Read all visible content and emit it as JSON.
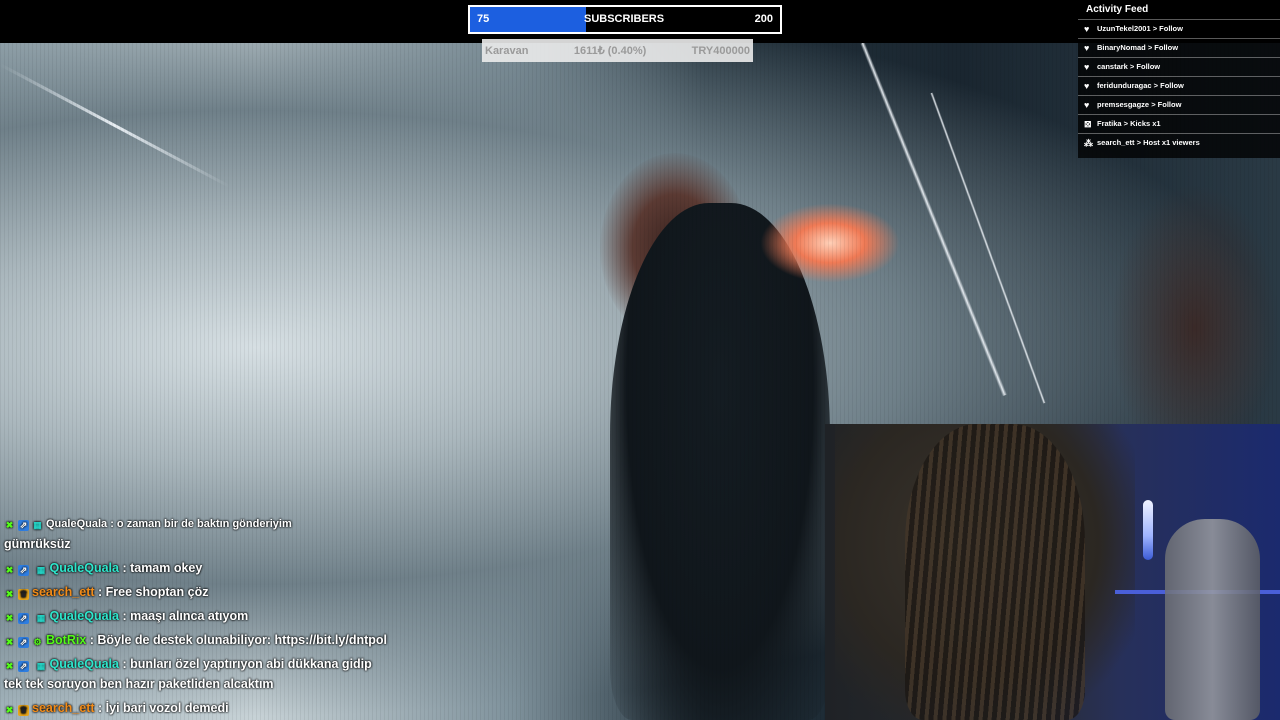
{
  "goal": {
    "current": "75",
    "label": "SUBSCRIBERS",
    "target": "200",
    "progress_fraction": 0.375,
    "fill_color": "#1c5fe0"
  },
  "donation": {
    "name": "Karavan",
    "amount": "1611₺ (0.40%)",
    "target": "TRY400000"
  },
  "activity_feed": {
    "title": "Activity Feed",
    "items": [
      {
        "icon": "heart-icon",
        "text": "UzunTekel2001 > Follow"
      },
      {
        "icon": "heart-icon",
        "text": "BinaryNomad > Follow"
      },
      {
        "icon": "heart-icon",
        "text": "canstark > Follow"
      },
      {
        "icon": "heart-icon",
        "text": "feridunduragac > Follow"
      },
      {
        "icon": "heart-icon",
        "text": "premsesgagze > Follow"
      },
      {
        "icon": "kick-icon",
        "text": "Fratika > Kicks x1"
      },
      {
        "icon": "viewers-icon",
        "text": "search_ett > Host x1 viewers"
      }
    ]
  },
  "chat": {
    "messages": [
      {
        "user": "QualeQuala",
        "sep": " : ",
        "text": "o zaman bir de baktın gönderiyim",
        "faded": true
      },
      {
        "user": "",
        "sep": "",
        "text": "gümrüksüz"
      },
      {
        "user": "QualeQuala",
        "sep": " : ",
        "text": "tamam okey"
      },
      {
        "user": "search_ett",
        "sep": " : ",
        "text": "Free shoptan çöz"
      },
      {
        "user": "QualeQuala",
        "sep": " : ",
        "text": "maaşı alınca atıyom"
      },
      {
        "user": "BotRix",
        "sep": " : ",
        "text": "Böyle de destek olunabiliyor: https://bit.ly/dntpol"
      },
      {
        "user": "QualeQuala",
        "sep": " : ",
        "text": "bunları özel yaptırıyon abi dükkana gidip"
      },
      {
        "user": "",
        "sep": "",
        "text": "tek tek soruyon ben hazır paketliden alcaktım"
      },
      {
        "user": "search_ett",
        "sep": " : ",
        "text": "İyi bari vozol demedi"
      }
    ]
  }
}
